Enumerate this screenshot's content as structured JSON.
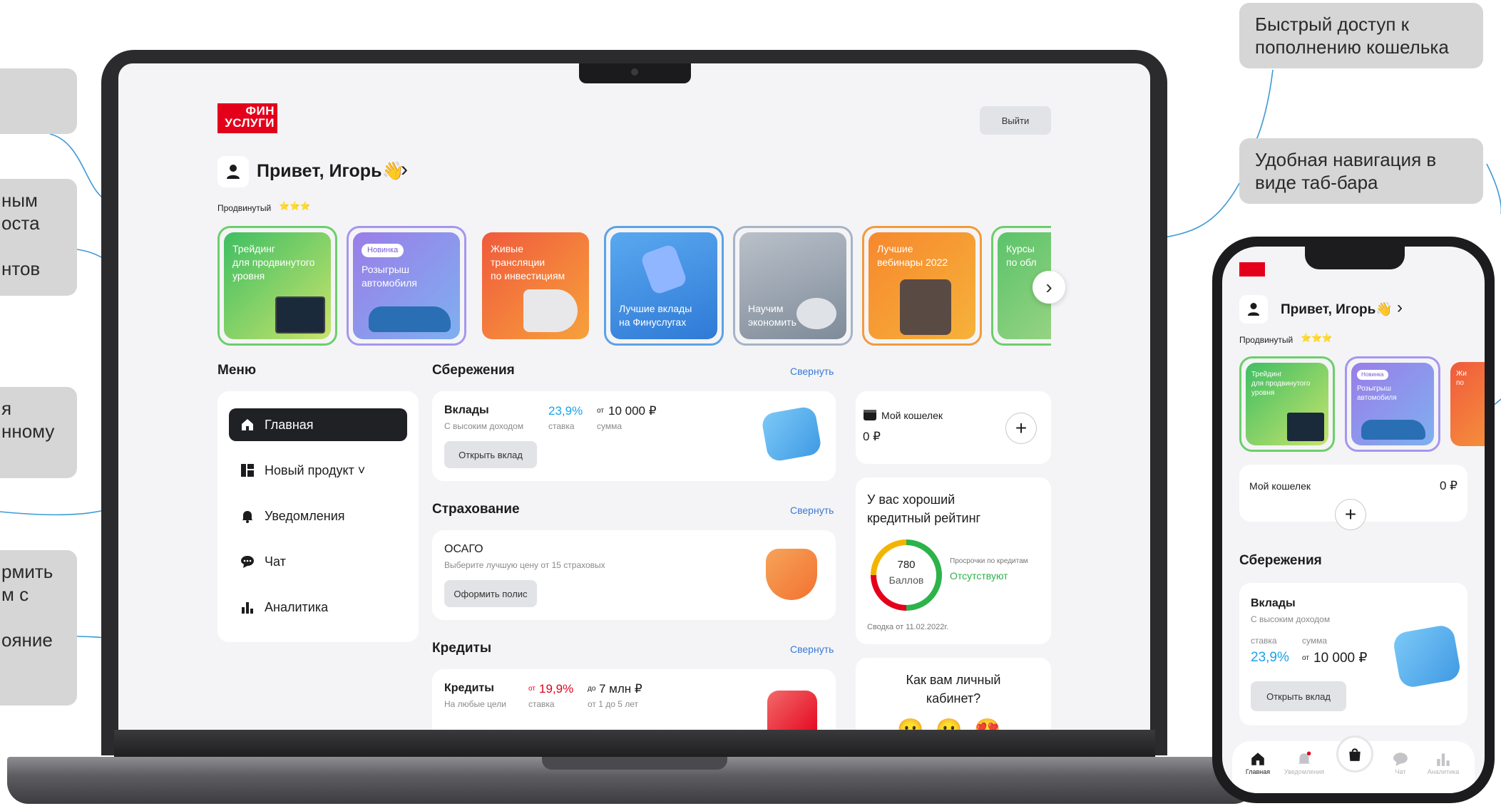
{
  "callouts": {
    "left": [
      {
        "text": ""
      },
      {
        "text": "ным\nоста\n\nнтов"
      },
      {
        "text": "я\nнному"
      },
      {
        "text": "рмить\nм с\n\nояние"
      }
    ],
    "right_top": "Быстрый доступ к\nпополнению кошелька",
    "right_mid": "Удобная навигация в\nвиде таб-бара"
  },
  "laptop": {
    "logo_line1": "ФИН",
    "logo_line2": "УСЛУГИ",
    "logout_label": "Выйти",
    "greeting": "Привет, Игорь👋",
    "greeting_chevron": "›",
    "level_label": "Продвинутый",
    "level_stars": "⭐⭐⭐",
    "stories": [
      {
        "title": "Трейдинг\nдля продвинутого\nуровня",
        "badge": ""
      },
      {
        "title": "Розыгрыш\nавтомобиля",
        "badge": "Новинка"
      },
      {
        "title": "Живые\nтрансляции\nпо инвестициям",
        "badge": ""
      },
      {
        "title": "Лучшие вклады\nна Финуслугах",
        "badge": ""
      },
      {
        "title": "Научим\nэкономить",
        "badge": ""
      },
      {
        "title": "Лучшие\nвебинары 2022",
        "badge": ""
      },
      {
        "title": "Курсы\nпо обл",
        "badge": ""
      }
    ],
    "stories_next": "›",
    "menu_title": "Меню",
    "menu_items": [
      {
        "label": "Главная"
      },
      {
        "label": "Новый продукт ˅"
      },
      {
        "label": "Уведомления"
      },
      {
        "label": "Чат"
      },
      {
        "label": "Аналитика"
      }
    ],
    "savings": {
      "title": "Сбережения",
      "collapse": "Свернуть",
      "product": "Вклады",
      "subtitle": "С высоким доходом",
      "rate": "23,9%",
      "rate_label": "ставка",
      "sum_prefix": "от",
      "sum": "10 000 ₽",
      "sum_label": "сумма",
      "button": "Открыть вклад"
    },
    "insurance": {
      "title": "Страхование",
      "collapse": "Свернуть",
      "product": "ОСАГО",
      "subtitle": "Выберите лучшую цену от 15 страховых",
      "button": "Оформить полис"
    },
    "credits": {
      "title": "Кредиты",
      "collapse": "Свернуть",
      "product": "Кредиты",
      "subtitle": "На любые цели",
      "rate_prefix": "от",
      "rate": "19,9%",
      "rate_label": "ставка",
      "sum_prefix": "до",
      "sum": "7 млн ₽",
      "sum_label": "от 1 до 5 лет"
    },
    "wallet": {
      "title": "Мой кошелек",
      "balance": "0 ₽",
      "add": "+"
    },
    "rating": {
      "title": "У вас хороший\nкредитный рейтинг",
      "score": "780",
      "score_label": "Баллов",
      "overdue_label": "Просрочки по кредитам",
      "overdue_value": "Отсутствуют",
      "summary": "Сводка от 11.02.2022г."
    },
    "feedback": {
      "title": "Как вам личный\nкабинет?",
      "emojis": [
        "😐",
        "😐",
        "😍"
      ]
    }
  },
  "phone": {
    "greeting": "Привет, Игорь👋",
    "greeting_chevron": "›",
    "level_label": "Продвинутый",
    "level_stars": "⭐⭐⭐",
    "stories": [
      {
        "title": "Трейдинг\nдля продвинутого\nуровня",
        "badge": ""
      },
      {
        "title": "Розыгрыш\nавтомобиля",
        "badge": "Новинка"
      },
      {
        "title": "Жи\nпо",
        "badge": ""
      }
    ],
    "wallet_title": "Мой кошелек",
    "wallet_balance": "0 ₽",
    "wallet_add": "+",
    "savings_title": "Сбережения",
    "product": "Вклады",
    "subtitle": "С высоким доходом",
    "rate_label": "ставка",
    "sum_label": "сумма",
    "rate": "23,9%",
    "sum_prefix": "от",
    "sum": "10 000 ₽",
    "button": "Открыть вклад",
    "tabs": [
      {
        "label": "Главная"
      },
      {
        "label": "Уведомления"
      },
      {
        "label": ""
      },
      {
        "label": "Чат"
      },
      {
        "label": "Аналитика"
      }
    ]
  },
  "colors": {
    "accent_blue": "#3a78d6",
    "brand_red": "#e4001b",
    "rate_blue": "#1aa3e8",
    "rate_red": "#e4001b",
    "good_green": "#2cb34a"
  }
}
